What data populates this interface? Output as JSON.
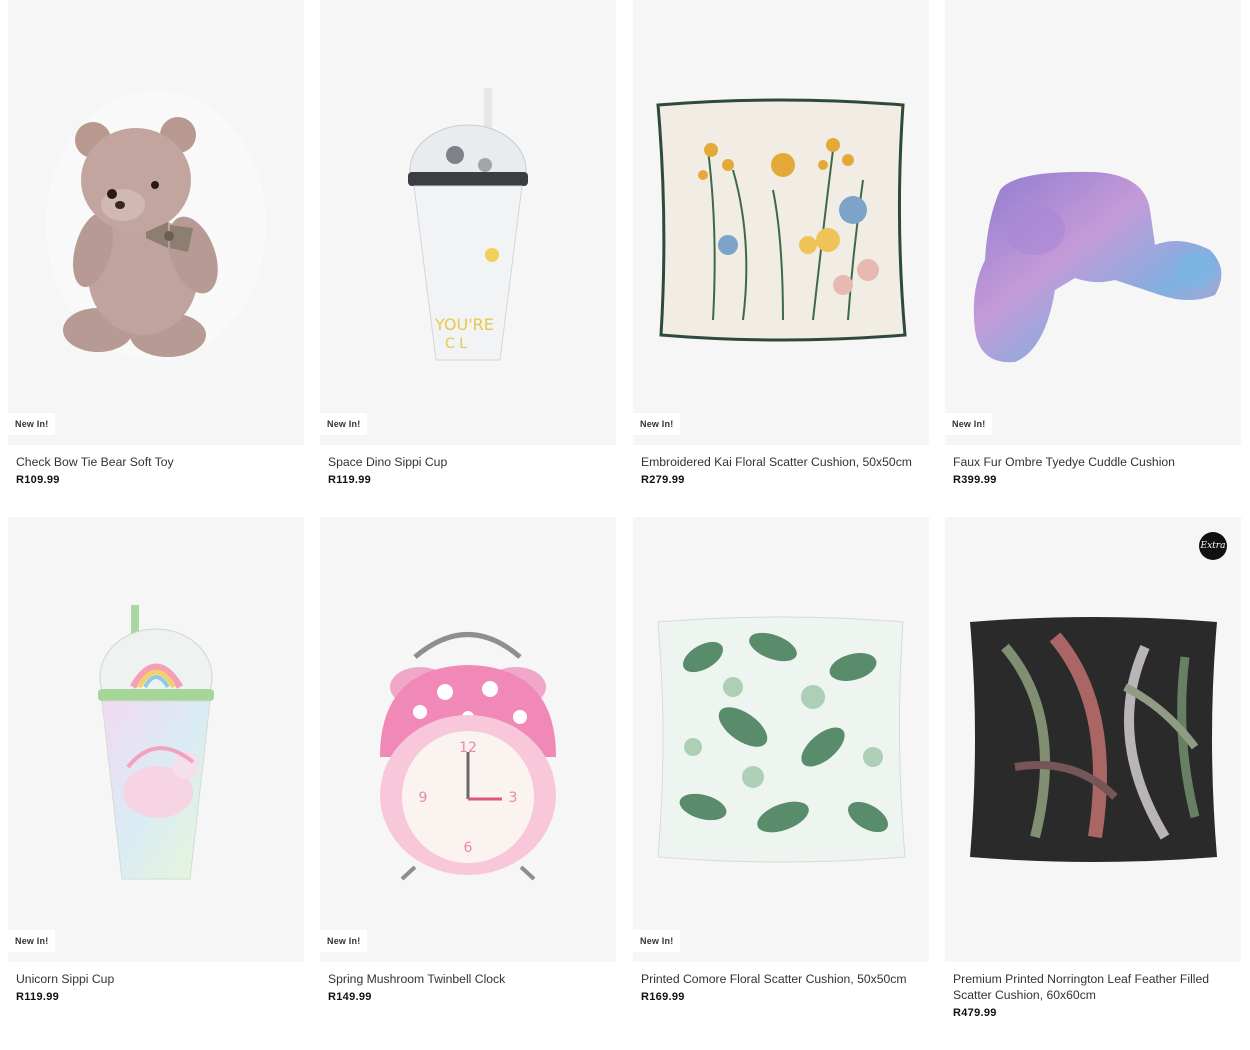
{
  "products": [
    {
      "name": "Check Bow Tie Bear Soft Toy",
      "price": "R109.99",
      "badge": "New In!",
      "image": "teddy-bear"
    },
    {
      "name": "Space Dino Sippi Cup",
      "price": "R119.99",
      "badge": "New In!",
      "image": "space-sippi-cup"
    },
    {
      "name": "Embroidered Kai Floral Scatter Cushion, 50x50cm",
      "price": "R279.99",
      "badge": "New In!",
      "image": "floral-cushion"
    },
    {
      "name": "Faux Fur Ombre Tyedye Cuddle Cushion",
      "price": "R399.99",
      "badge": "New In!",
      "image": "cuddle-cushion"
    },
    {
      "name": "Unicorn Sippi Cup",
      "price": "R119.99",
      "badge": "New In!",
      "image": "unicorn-sippi-cup"
    },
    {
      "name": "Spring Mushroom Twinbell Clock",
      "price": "R149.99",
      "badge": "New In!",
      "image": "mushroom-clock"
    },
    {
      "name": "Printed Comore Floral Scatter Cushion, 50x50cm",
      "price": "R169.99",
      "badge": "New In!",
      "image": "green-floral-cushion"
    },
    {
      "name": "Premium Printed Norrington Leaf Feather Filled Scatter Cushion, 60x60cm",
      "price": "R479.99",
      "badge": "",
      "extra_badge": "Extra",
      "image": "leaf-cushion"
    }
  ],
  "colors": {
    "image_bg": "#f6f6f6",
    "badge_bg": "#ffffff",
    "price_text": "#111111",
    "extra_badge_bg": "#111111"
  }
}
